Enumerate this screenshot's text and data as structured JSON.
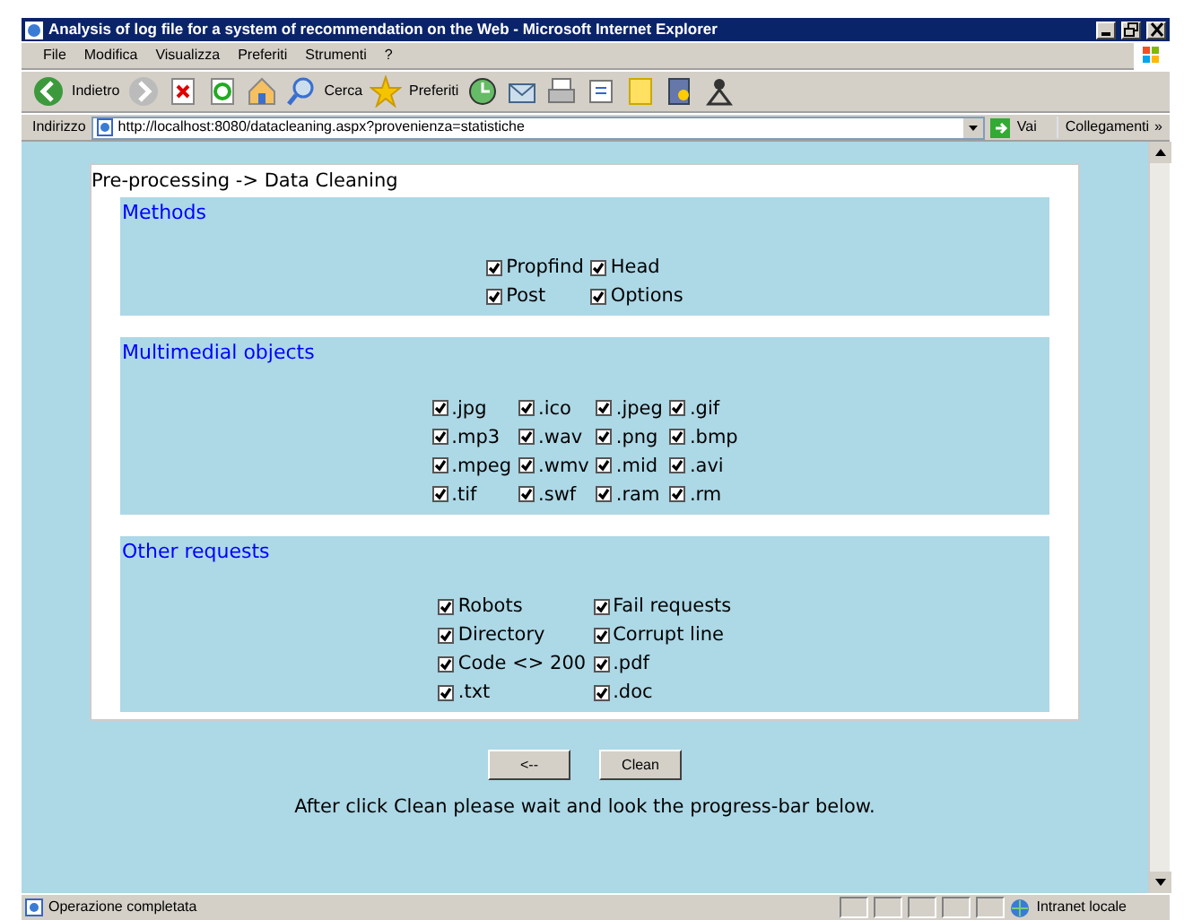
{
  "window": {
    "title": "Analysis of log file for a system of recommendation on the Web - Microsoft Internet Explorer"
  },
  "menu": [
    "File",
    "Modifica",
    "Visualizza",
    "Preferiti",
    "Strumenti",
    "?"
  ],
  "toolbar": [
    {
      "kind": "back",
      "label": "Indietro"
    },
    {
      "kind": "forward"
    },
    {
      "kind": "stop"
    },
    {
      "kind": "refresh"
    },
    {
      "kind": "home"
    },
    {
      "kind": "search",
      "label": "Cerca"
    },
    {
      "kind": "favorites",
      "label": "Preferiti"
    },
    {
      "kind": "history"
    },
    {
      "kind": "mail"
    },
    {
      "kind": "print"
    },
    {
      "kind": "edit"
    },
    {
      "kind": "note"
    },
    {
      "kind": "research"
    },
    {
      "kind": "messenger"
    }
  ],
  "address": {
    "label": "Indirizzo",
    "value": "http://localhost:8080/datacleaning.aspx?provenienza=statistiche",
    "go": "Vai",
    "links": "Collegamenti",
    "more": "»"
  },
  "page": {
    "heading": "Pre-processing -> Data Cleaning",
    "sections": [
      {
        "title": "Methods",
        "kind": "methods",
        "options": [
          {
            "label": "Propfind",
            "checked": true
          },
          {
            "label": "Head",
            "checked": true
          },
          {
            "label": "Post",
            "checked": true
          },
          {
            "label": "Options",
            "checked": true
          }
        ]
      },
      {
        "title": "Multimedial objects",
        "kind": "extensions",
        "options": [
          {
            "label": ".jpg",
            "checked": true
          },
          {
            "label": ".ico",
            "checked": true
          },
          {
            "label": ".jpeg",
            "checked": true
          },
          {
            "label": ".gif",
            "checked": true
          },
          {
            "label": ".mp3",
            "checked": true
          },
          {
            "label": ".wav",
            "checked": true
          },
          {
            "label": ".png",
            "checked": true
          },
          {
            "label": ".bmp",
            "checked": true
          },
          {
            "label": ".mpeg",
            "checked": true
          },
          {
            "label": ".wmv",
            "checked": true
          },
          {
            "label": ".mid",
            "checked": true
          },
          {
            "label": ".avi",
            "checked": true
          },
          {
            "label": ".tif",
            "checked": true
          },
          {
            "label": ".swf",
            "checked": true
          },
          {
            "label": ".ram",
            "checked": true
          },
          {
            "label": ".rm",
            "checked": true
          }
        ]
      },
      {
        "title": "Other requests",
        "kind": "requests",
        "options": [
          {
            "label": "Robots",
            "checked": true
          },
          {
            "label": "Fail requests",
            "checked": true
          },
          {
            "label": "Directory",
            "checked": true
          },
          {
            "label": "Corrupt line",
            "checked": true
          },
          {
            "label": "Code <> 200",
            "checked": true
          },
          {
            "label": ".pdf",
            "checked": true
          },
          {
            "label": ".txt",
            "checked": true
          },
          {
            "label": ".doc",
            "checked": true
          }
        ]
      }
    ],
    "buttons": [
      "<--",
      "Clean"
    ],
    "note": "After click Clean please wait and look the progress-bar below."
  },
  "status_bar": {
    "text": "Operazione completata",
    "zone": "Intranet locale"
  }
}
